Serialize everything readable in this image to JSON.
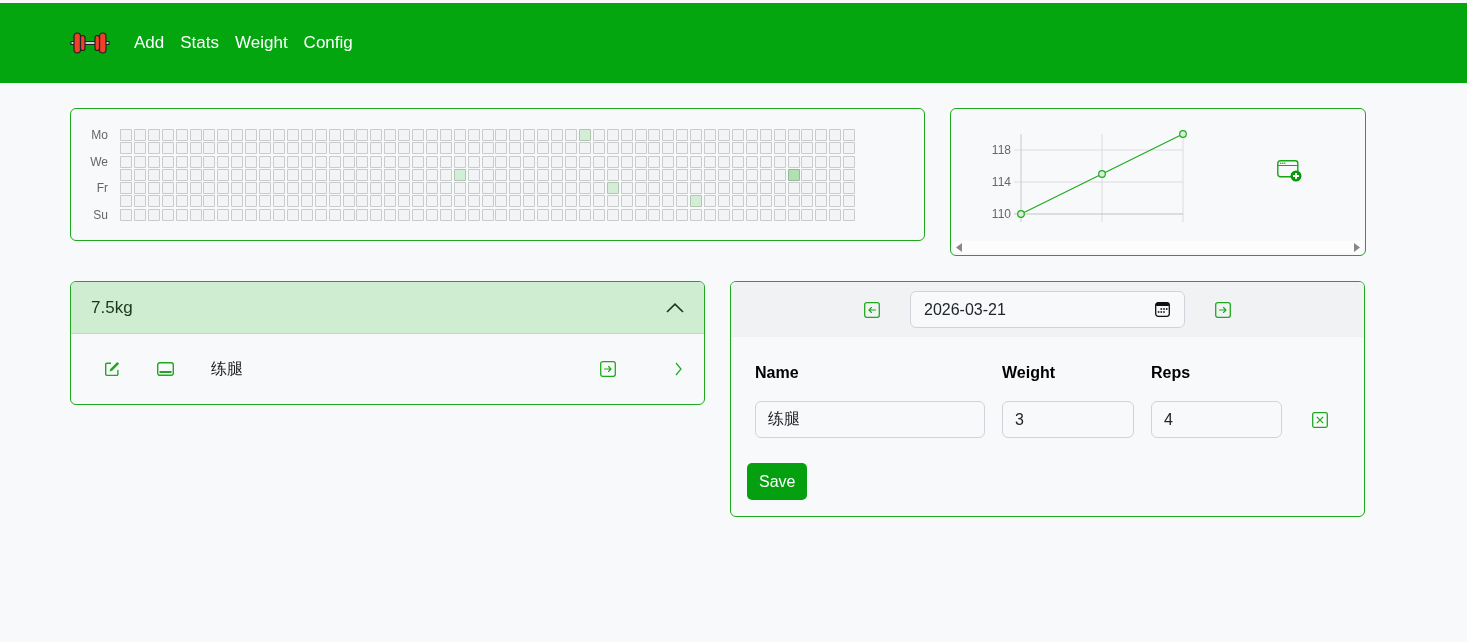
{
  "nav": {
    "items": [
      {
        "label": "Add"
      },
      {
        "label": "Stats"
      },
      {
        "label": "Weight"
      },
      {
        "label": "Config"
      }
    ]
  },
  "activity_grid": {
    "day_labels": [
      "Mo",
      "We",
      "Fr",
      "Su"
    ],
    "weeks": [
      {
        "days": [
          {
            "color": "#f3f4f6"
          },
          {
            "color": "#f3f4f6"
          },
          {
            "color": "#f3f4f6"
          },
          {
            "color": "#f3f4f6"
          },
          {
            "color": "#f3f4f6"
          },
          {
            "color": "#f3f4f6"
          },
          {
            "color": "#f3f4f6"
          }
        ]
      },
      {
        "days": [
          {
            "color": "#f3f4f6"
          },
          {
            "color": "#f3f4f6"
          },
          {
            "color": "#f3f4f6"
          },
          {
            "color": "#f3f4f6"
          },
          {
            "color": "#f3f4f6"
          },
          {
            "color": "#f3f4f6"
          },
          {
            "color": "#f3f4f6"
          }
        ]
      },
      {
        "days": [
          {
            "color": "#f3f4f6"
          },
          {
            "color": "#f3f4f6"
          },
          {
            "color": "#f3f4f6"
          },
          {
            "color": "#f3f4f6"
          },
          {
            "color": "#f3f4f6"
          },
          {
            "color": "#f3f4f6"
          },
          {
            "color": "#f3f4f6"
          }
        ]
      },
      {
        "days": [
          {
            "color": "#f3f4f6"
          },
          {
            "color": "#f3f4f6"
          },
          {
            "color": "#f3f4f6"
          },
          {
            "color": "#f3f4f6"
          },
          {
            "color": "#f3f4f6"
          },
          {
            "color": "#f3f4f6"
          },
          {
            "color": "#f3f4f6"
          }
        ]
      },
      {
        "days": [
          {
            "color": "#f3f4f6"
          },
          {
            "color": "#f3f4f6"
          },
          {
            "color": "#f3f4f6"
          },
          {
            "color": "#f3f4f6"
          },
          {
            "color": "#f3f4f6"
          },
          {
            "color": "#f3f4f6"
          },
          {
            "color": "#f3f4f6"
          }
        ]
      },
      {
        "days": [
          {
            "color": "#f3f4f6"
          },
          {
            "color": "#f3f4f6"
          },
          {
            "color": "#f3f4f6"
          },
          {
            "color": "#f3f4f6"
          },
          {
            "color": "#f3f4f6"
          },
          {
            "color": "#f3f4f6"
          },
          {
            "color": "#f3f4f6"
          }
        ]
      },
      {
        "days": [
          {
            "color": "#f3f4f6"
          },
          {
            "color": "#f3f4f6"
          },
          {
            "color": "#f3f4f6"
          },
          {
            "color": "#f3f4f6"
          },
          {
            "color": "#f3f4f6"
          },
          {
            "color": "#f3f4f6"
          },
          {
            "color": "#f3f4f6"
          }
        ]
      },
      {
        "days": [
          {
            "color": "#f3f4f6"
          },
          {
            "color": "#f3f4f6"
          },
          {
            "color": "#f3f4f6"
          },
          {
            "color": "#f3f4f6"
          },
          {
            "color": "#f3f4f6"
          },
          {
            "color": "#f3f4f6"
          },
          {
            "color": "#f3f4f6"
          }
        ]
      },
      {
        "days": [
          {
            "color": "#f3f4f6"
          },
          {
            "color": "#f3f4f6"
          },
          {
            "color": "#f3f4f6"
          },
          {
            "color": "#f3f4f6"
          },
          {
            "color": "#f3f4f6"
          },
          {
            "color": "#f3f4f6"
          },
          {
            "color": "#f3f4f6"
          }
        ]
      },
      {
        "days": [
          {
            "color": "#f3f4f6"
          },
          {
            "color": "#f3f4f6"
          },
          {
            "color": "#f3f4f6"
          },
          {
            "color": "#f3f4f6"
          },
          {
            "color": "#f3f4f6"
          },
          {
            "color": "#f3f4f6"
          },
          {
            "color": "#f3f4f6"
          }
        ]
      },
      {
        "days": [
          {
            "color": "#f3f4f6"
          },
          {
            "color": "#f3f4f6"
          },
          {
            "color": "#f3f4f6"
          },
          {
            "color": "#f3f4f6"
          },
          {
            "color": "#f3f4f6"
          },
          {
            "color": "#f3f4f6"
          },
          {
            "color": "#f3f4f6"
          }
        ]
      },
      {
        "days": [
          {
            "color": "#f3f4f6"
          },
          {
            "color": "#f3f4f6"
          },
          {
            "color": "#f3f4f6"
          },
          {
            "color": "#f3f4f6"
          },
          {
            "color": "#f3f4f6"
          },
          {
            "color": "#f3f4f6"
          },
          {
            "color": "#f3f4f6"
          }
        ]
      },
      {
        "days": [
          {
            "color": "#f3f4f6"
          },
          {
            "color": "#f3f4f6"
          },
          {
            "color": "#f3f4f6"
          },
          {
            "color": "#f3f4f6"
          },
          {
            "color": "#f3f4f6"
          },
          {
            "color": "#f3f4f6"
          },
          {
            "color": "#f3f4f6"
          }
        ]
      },
      {
        "days": [
          {
            "color": "#f3f4f6"
          },
          {
            "color": "#f3f4f6"
          },
          {
            "color": "#f3f4f6"
          },
          {
            "color": "#f3f4f6"
          },
          {
            "color": "#f3f4f6"
          },
          {
            "color": "#f3f4f6"
          },
          {
            "color": "#f3f4f6"
          }
        ]
      },
      {
        "days": [
          {
            "color": "#f3f4f6"
          },
          {
            "color": "#f3f4f6"
          },
          {
            "color": "#f3f4f6"
          },
          {
            "color": "#f3f4f6"
          },
          {
            "color": "#f3f4f6"
          },
          {
            "color": "#f3f4f6"
          },
          {
            "color": "#f3f4f6"
          }
        ]
      },
      {
        "days": [
          {
            "color": "#f3f4f6"
          },
          {
            "color": "#f3f4f6"
          },
          {
            "color": "#f3f4f6"
          },
          {
            "color": "#f3f4f6"
          },
          {
            "color": "#f3f4f6"
          },
          {
            "color": "#f3f4f6"
          },
          {
            "color": "#f3f4f6"
          }
        ]
      },
      {
        "days": [
          {
            "color": "#f3f4f6"
          },
          {
            "color": "#f3f4f6"
          },
          {
            "color": "#f3f4f6"
          },
          {
            "color": "#f3f4f6"
          },
          {
            "color": "#f3f4f6"
          },
          {
            "color": "#f3f4f6"
          },
          {
            "color": "#f3f4f6"
          }
        ]
      },
      {
        "days": [
          {
            "color": "#f3f4f6"
          },
          {
            "color": "#f3f4f6"
          },
          {
            "color": "#f3f4f6"
          },
          {
            "color": "#f3f4f6"
          },
          {
            "color": "#f3f4f6"
          },
          {
            "color": "#f3f4f6"
          },
          {
            "color": "#f3f4f6"
          }
        ]
      },
      {
        "days": [
          {
            "color": "#f3f4f6"
          },
          {
            "color": "#f3f4f6"
          },
          {
            "color": "#f3f4f6"
          },
          {
            "color": "#f3f4f6"
          },
          {
            "color": "#f3f4f6"
          },
          {
            "color": "#f3f4f6"
          },
          {
            "color": "#f3f4f6"
          }
        ]
      },
      {
        "days": [
          {
            "color": "#f3f4f6"
          },
          {
            "color": "#f3f4f6"
          },
          {
            "color": "#f3f4f6"
          },
          {
            "color": "#f3f4f6"
          },
          {
            "color": "#f3f4f6"
          },
          {
            "color": "#f3f4f6"
          },
          {
            "color": "#f3f4f6"
          }
        ]
      },
      {
        "days": [
          {
            "color": "#f3f4f6"
          },
          {
            "color": "#f3f4f6"
          },
          {
            "color": "#f3f4f6"
          },
          {
            "color": "#f3f4f6"
          },
          {
            "color": "#f3f4f6"
          },
          {
            "color": "#f3f4f6"
          },
          {
            "color": "#f3f4f6"
          }
        ]
      },
      {
        "days": [
          {
            "color": "#f3f4f6"
          },
          {
            "color": "#f3f4f6"
          },
          {
            "color": "#f3f4f6"
          },
          {
            "color": "#f3f4f6"
          },
          {
            "color": "#f3f4f6"
          },
          {
            "color": "#f3f4f6"
          },
          {
            "color": "#f3f4f6"
          }
        ]
      },
      {
        "days": [
          {
            "color": "#f3f4f6"
          },
          {
            "color": "#f3f4f6"
          },
          {
            "color": "#f3f4f6"
          },
          {
            "color": "#f3f4f6"
          },
          {
            "color": "#f3f4f6"
          },
          {
            "color": "#f3f4f6"
          },
          {
            "color": "#f3f4f6"
          }
        ]
      },
      {
        "days": [
          {
            "color": "#f3f4f6"
          },
          {
            "color": "#f3f4f6"
          },
          {
            "color": "#f3f4f6"
          },
          {
            "color": "#f3f4f6"
          },
          {
            "color": "#f3f4f6"
          },
          {
            "color": "#f3f4f6"
          },
          {
            "color": "#f3f4f6"
          }
        ]
      },
      {
        "days": [
          {
            "color": "#f3f4f6"
          },
          {
            "color": "#f3f4f6"
          },
          {
            "color": "#f3f4f6"
          },
          {
            "color": "#d4edd6"
          },
          {
            "color": "#f3f4f6"
          },
          {
            "color": "#f3f4f6"
          },
          {
            "color": "#f3f4f6"
          }
        ]
      },
      {
        "days": [
          {
            "color": "#f3f4f6"
          },
          {
            "color": "#f3f4f6"
          },
          {
            "color": "#f3f4f6"
          },
          {
            "color": "#f3f4f6"
          },
          {
            "color": "#f3f4f6"
          },
          {
            "color": "#f3f4f6"
          },
          {
            "color": "#f3f4f6"
          }
        ]
      },
      {
        "days": [
          {
            "color": "#f3f4f6"
          },
          {
            "color": "#f3f4f6"
          },
          {
            "color": "#f3f4f6"
          },
          {
            "color": "#f3f4f6"
          },
          {
            "color": "#f3f4f6"
          },
          {
            "color": "#f3f4f6"
          },
          {
            "color": "#f3f4f6"
          }
        ]
      },
      {
        "days": [
          {
            "color": "#f3f4f6"
          },
          {
            "color": "#f3f4f6"
          },
          {
            "color": "#f3f4f6"
          },
          {
            "color": "#f3f4f6"
          },
          {
            "color": "#f3f4f6"
          },
          {
            "color": "#f3f4f6"
          },
          {
            "color": "#f3f4f6"
          }
        ]
      },
      {
        "days": [
          {
            "color": "#f3f4f6"
          },
          {
            "color": "#f3f4f6"
          },
          {
            "color": "#f3f4f6"
          },
          {
            "color": "#f3f4f6"
          },
          {
            "color": "#f3f4f6"
          },
          {
            "color": "#f3f4f6"
          },
          {
            "color": "#f3f4f6"
          }
        ]
      },
      {
        "days": [
          {
            "color": "#f3f4f6"
          },
          {
            "color": "#f3f4f6"
          },
          {
            "color": "#f3f4f6"
          },
          {
            "color": "#f3f4f6"
          },
          {
            "color": "#f3f4f6"
          },
          {
            "color": "#f3f4f6"
          },
          {
            "color": "#f3f4f6"
          }
        ]
      },
      {
        "days": [
          {
            "color": "#f3f4f6"
          },
          {
            "color": "#f3f4f6"
          },
          {
            "color": "#f3f4f6"
          },
          {
            "color": "#f3f4f6"
          },
          {
            "color": "#f3f4f6"
          },
          {
            "color": "#f3f4f6"
          },
          {
            "color": "#f3f4f6"
          }
        ]
      },
      {
        "days": [
          {
            "color": "#f3f4f6"
          },
          {
            "color": "#f3f4f6"
          },
          {
            "color": "#f3f4f6"
          },
          {
            "color": "#f3f4f6"
          },
          {
            "color": "#f3f4f6"
          },
          {
            "color": "#f3f4f6"
          },
          {
            "color": "#f3f4f6"
          }
        ]
      },
      {
        "days": [
          {
            "color": "#f3f4f6"
          },
          {
            "color": "#f3f4f6"
          },
          {
            "color": "#f3f4f6"
          },
          {
            "color": "#f3f4f6"
          },
          {
            "color": "#f3f4f6"
          },
          {
            "color": "#f3f4f6"
          },
          {
            "color": "#f3f4f6"
          }
        ]
      },
      {
        "days": [
          {
            "color": "#d4edd6"
          },
          {
            "color": "#f3f4f6"
          },
          {
            "color": "#f3f4f6"
          },
          {
            "color": "#f3f4f6"
          },
          {
            "color": "#f3f4f6"
          },
          {
            "color": "#f3f4f6"
          },
          {
            "color": "#f3f4f6"
          }
        ]
      },
      {
        "days": [
          {
            "color": "#f3f4f6"
          },
          {
            "color": "#f3f4f6"
          },
          {
            "color": "#f3f4f6"
          },
          {
            "color": "#f3f4f6"
          },
          {
            "color": "#f3f4f6"
          },
          {
            "color": "#f3f4f6"
          },
          {
            "color": "#f3f4f6"
          }
        ]
      },
      {
        "days": [
          {
            "color": "#f3f4f6"
          },
          {
            "color": "#f3f4f6"
          },
          {
            "color": "#f3f4f6"
          },
          {
            "color": "#f3f4f6"
          },
          {
            "color": "#d4edd6"
          },
          {
            "color": "#f3f4f6"
          },
          {
            "color": "#f3f4f6"
          }
        ]
      },
      {
        "days": [
          {
            "color": "#f3f4f6"
          },
          {
            "color": "#f3f4f6"
          },
          {
            "color": "#f3f4f6"
          },
          {
            "color": "#f3f4f6"
          },
          {
            "color": "#f3f4f6"
          },
          {
            "color": "#f3f4f6"
          },
          {
            "color": "#f3f4f6"
          }
        ]
      },
      {
        "days": [
          {
            "color": "#f3f4f6"
          },
          {
            "color": "#f3f4f6"
          },
          {
            "color": "#f3f4f6"
          },
          {
            "color": "#f3f4f6"
          },
          {
            "color": "#f3f4f6"
          },
          {
            "color": "#f3f4f6"
          },
          {
            "color": "#f3f4f6"
          }
        ]
      },
      {
        "days": [
          {
            "color": "#f3f4f6"
          },
          {
            "color": "#f3f4f6"
          },
          {
            "color": "#f3f4f6"
          },
          {
            "color": "#f3f4f6"
          },
          {
            "color": "#f3f4f6"
          },
          {
            "color": "#f3f4f6"
          },
          {
            "color": "#f3f4f6"
          }
        ]
      },
      {
        "days": [
          {
            "color": "#f3f4f6"
          },
          {
            "color": "#f3f4f6"
          },
          {
            "color": "#f3f4f6"
          },
          {
            "color": "#f3f4f6"
          },
          {
            "color": "#f3f4f6"
          },
          {
            "color": "#f3f4f6"
          },
          {
            "color": "#f3f4f6"
          }
        ]
      },
      {
        "days": [
          {
            "color": "#f3f4f6"
          },
          {
            "color": "#f3f4f6"
          },
          {
            "color": "#f3f4f6"
          },
          {
            "color": "#f3f4f6"
          },
          {
            "color": "#f3f4f6"
          },
          {
            "color": "#f3f4f6"
          },
          {
            "color": "#f3f4f6"
          }
        ]
      },
      {
        "days": [
          {
            "color": "#f3f4f6"
          },
          {
            "color": "#f3f4f6"
          },
          {
            "color": "#f3f4f6"
          },
          {
            "color": "#f3f4f6"
          },
          {
            "color": "#f3f4f6"
          },
          {
            "color": "#d4edd6"
          },
          {
            "color": "#f3f4f6"
          }
        ]
      },
      {
        "days": [
          {
            "color": "#f3f4f6"
          },
          {
            "color": "#f3f4f6"
          },
          {
            "color": "#f3f4f6"
          },
          {
            "color": "#f3f4f6"
          },
          {
            "color": "#f3f4f6"
          },
          {
            "color": "#f3f4f6"
          },
          {
            "color": "#f3f4f6"
          }
        ]
      },
      {
        "days": [
          {
            "color": "#f3f4f6"
          },
          {
            "color": "#f3f4f6"
          },
          {
            "color": "#f3f4f6"
          },
          {
            "color": "#f3f4f6"
          },
          {
            "color": "#f3f4f6"
          },
          {
            "color": "#f3f4f6"
          },
          {
            "color": "#f3f4f6"
          }
        ]
      },
      {
        "days": [
          {
            "color": "#f3f4f6"
          },
          {
            "color": "#f3f4f6"
          },
          {
            "color": "#f3f4f6"
          },
          {
            "color": "#f3f4f6"
          },
          {
            "color": "#f3f4f6"
          },
          {
            "color": "#f3f4f6"
          },
          {
            "color": "#f3f4f6"
          }
        ]
      },
      {
        "days": [
          {
            "color": "#f3f4f6"
          },
          {
            "color": "#f3f4f6"
          },
          {
            "color": "#f3f4f6"
          },
          {
            "color": "#f3f4f6"
          },
          {
            "color": "#f3f4f6"
          },
          {
            "color": "#f3f4f6"
          },
          {
            "color": "#f3f4f6"
          }
        ]
      },
      {
        "days": [
          {
            "color": "#f3f4f6"
          },
          {
            "color": "#f3f4f6"
          },
          {
            "color": "#f3f4f6"
          },
          {
            "color": "#f3f4f6"
          },
          {
            "color": "#f3f4f6"
          },
          {
            "color": "#f3f4f6"
          },
          {
            "color": "#f3f4f6"
          }
        ]
      },
      {
        "days": [
          {
            "color": "#f3f4f6"
          },
          {
            "color": "#f3f4f6"
          },
          {
            "color": "#f3f4f6"
          },
          {
            "color": "#f3f4f6"
          },
          {
            "color": "#f3f4f6"
          },
          {
            "color": "#f3f4f6"
          },
          {
            "color": "#f3f4f6"
          }
        ]
      },
      {
        "days": [
          {
            "color": "#f3f4f6"
          },
          {
            "color": "#f3f4f6"
          },
          {
            "color": "#f3f4f6"
          },
          {
            "color": "#b3dfb5"
          },
          {
            "color": "#f3f4f6"
          },
          {
            "color": "#f3f4f6"
          },
          {
            "color": "#f3f4f6"
          }
        ]
      },
      {
        "days": [
          {
            "color": "#f3f4f6"
          },
          {
            "color": "#f3f4f6"
          },
          {
            "color": "#f3f4f6"
          },
          {
            "color": "#f3f4f6"
          },
          {
            "color": "#f3f4f6"
          },
          {
            "color": "#f3f4f6"
          },
          {
            "color": "#f3f4f6"
          }
        ]
      },
      {
        "days": [
          {
            "color": "#f3f4f6"
          },
          {
            "color": "#f3f4f6"
          },
          {
            "color": "#f3f4f6"
          },
          {
            "color": "#f3f4f6"
          },
          {
            "color": "#f3f4f6"
          },
          {
            "color": "#f3f4f6"
          },
          {
            "color": "#f3f4f6"
          }
        ]
      },
      {
        "days": [
          {
            "color": "#f3f4f6"
          },
          {
            "color": "#f3f4f6"
          },
          {
            "color": "#f3f4f6"
          },
          {
            "color": "#f3f4f6"
          },
          {
            "color": "#f3f4f6"
          },
          {
            "color": "#f3f4f6"
          },
          {
            "color": "#f3f4f6"
          }
        ]
      },
      {
        "days": [
          {
            "color": "#f3f4f6"
          },
          {
            "color": "#f3f4f6"
          },
          {
            "color": "#f3f4f6"
          },
          {
            "color": "#f3f4f6"
          },
          {
            "color": "#f3f4f6"
          },
          {
            "color": "#f3f4f6"
          },
          {
            "color": "#f3f4f6"
          }
        ]
      }
    ]
  },
  "weight_chart": {
    "chart_data": {
      "type": "line",
      "grid": true,
      "ylim": [
        110,
        120
      ],
      "yticks": [
        110,
        114,
        118
      ],
      "series": [
        {
          "color": "#22aa22",
          "marker": "circle",
          "values": [
            110,
            115,
            120
          ]
        }
      ]
    }
  },
  "exercise_group": {
    "title": "7.5kg",
    "expanded": true,
    "entries": [
      {
        "name": "练腿"
      }
    ]
  },
  "log_form": {
    "date": "2026-03-21",
    "columns": [
      "Name",
      "Weight",
      "Reps"
    ],
    "rows": [
      {
        "name": "练腿",
        "weight": "3",
        "reps": "4"
      }
    ],
    "save_label": "Save"
  }
}
